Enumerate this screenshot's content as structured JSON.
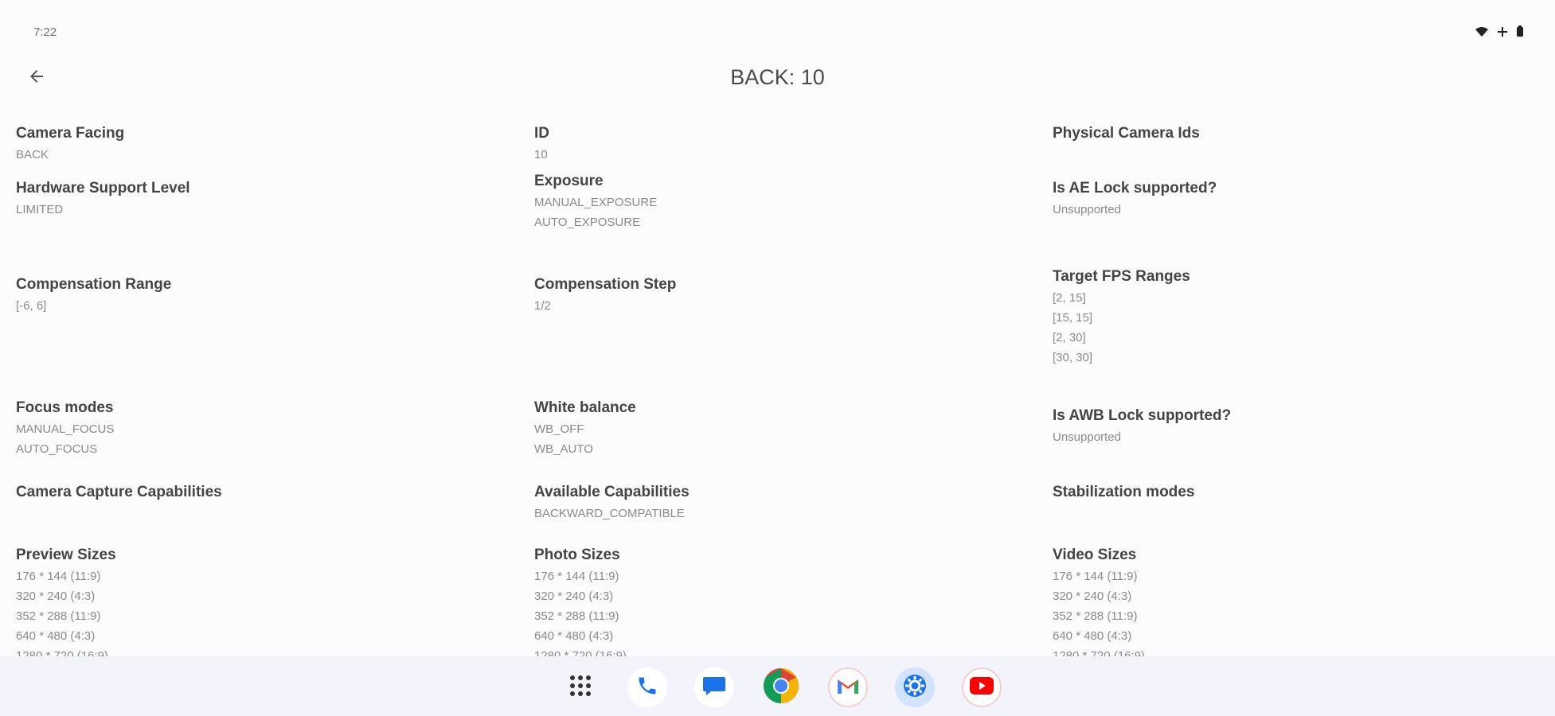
{
  "status_bar": {
    "time": "7:22"
  },
  "header": {
    "title": "BACK: 10",
    "back_icon": "arrow-back-icon"
  },
  "columns": [
    {
      "fields": [
        {
          "label": "Camera Facing",
          "values": [
            "BACK"
          ]
        },
        {
          "label": "Hardware Support Level",
          "values": [
            "LIMITED"
          ]
        },
        {
          "label": "Compensation Range",
          "values": [
            "[-6, 6]"
          ]
        },
        {
          "label": "Focus modes",
          "values": [
            "MANUAL_FOCUS",
            "AUTO_FOCUS"
          ]
        },
        {
          "label": "Camera Capture Capabilities",
          "values": []
        },
        {
          "label": "Preview Sizes",
          "values": [
            "176 * 144 (11:9)",
            "320 * 240 (4:3)",
            "352 * 288 (11:9)",
            "640 * 480 (4:3)",
            "1280 * 720 (16:9)"
          ]
        }
      ]
    },
    {
      "fields": [
        {
          "label": "ID",
          "values": [
            "10"
          ]
        },
        {
          "label": "Exposure",
          "values": [
            "MANUAL_EXPOSURE",
            "AUTO_EXPOSURE"
          ]
        },
        {
          "label": "Compensation Step",
          "values": [
            "1/2"
          ]
        },
        {
          "label": "White balance",
          "values": [
            "WB_OFF",
            "WB_AUTO"
          ]
        },
        {
          "label": "Available Capabilities",
          "values": [
            "BACKWARD_COMPATIBLE"
          ]
        },
        {
          "label": "Photo Sizes",
          "values": [
            "176 * 144 (11:9)",
            "320 * 240 (4:3)",
            "352 * 288 (11:9)",
            "640 * 480 (4:3)",
            "1280 * 720 (16:9)"
          ]
        }
      ]
    },
    {
      "fields": [
        {
          "label": "Physical Camera Ids",
          "values": []
        },
        {
          "label": "Is AE Lock supported?",
          "values": [
            "Unsupported"
          ]
        },
        {
          "label": "Target FPS Ranges",
          "values": [
            "[2, 15]",
            "[15, 15]",
            "[2, 30]",
            "[30, 30]"
          ]
        },
        {
          "label": "Is AWB Lock supported?",
          "values": [
            "Unsupported"
          ]
        },
        {
          "label": "Stabilization modes",
          "values": []
        },
        {
          "label": "Video Sizes",
          "values": [
            "176 * 144 (11:9)",
            "320 * 240 (4:3)",
            "352 * 288 (11:9)",
            "640 * 480 (4:3)",
            "1280 * 720 (16:9)"
          ]
        }
      ]
    }
  ],
  "dock": {
    "apps": [
      {
        "name": "app-drawer-icon"
      },
      {
        "name": "phone-icon"
      },
      {
        "name": "messages-icon"
      },
      {
        "name": "chrome-icon"
      },
      {
        "name": "gmail-icon"
      },
      {
        "name": "settings-icon"
      },
      {
        "name": "youtube-icon"
      }
    ]
  },
  "colors": {
    "background": "#fefbff",
    "nav_bar": "#f3f3fb",
    "label": "#444444",
    "value": "#8a8a8a"
  }
}
